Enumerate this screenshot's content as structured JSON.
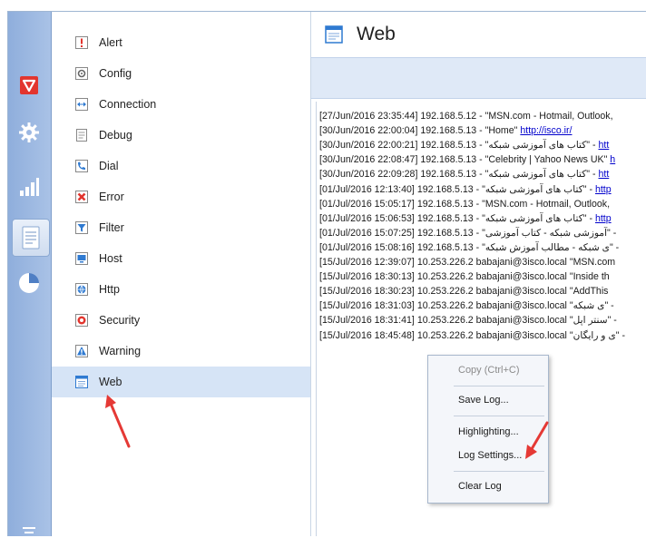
{
  "sidebar_rail": {
    "icons": [
      "shield-icon",
      "gear-icon",
      "signal-bars-icon",
      "document-icon",
      "pie-chart-icon",
      "collapse-icon"
    ],
    "selected": "document-icon"
  },
  "categories": {
    "items": [
      {
        "label": "Alert",
        "icon": "alert-icon"
      },
      {
        "label": "Config",
        "icon": "config-icon"
      },
      {
        "label": "Connection",
        "icon": "connection-icon"
      },
      {
        "label": "Debug",
        "icon": "debug-icon"
      },
      {
        "label": "Dial",
        "icon": "dial-icon"
      },
      {
        "label": "Error",
        "icon": "error-icon"
      },
      {
        "label": "Filter",
        "icon": "filter-icon"
      },
      {
        "label": "Host",
        "icon": "host-icon"
      },
      {
        "label": "Http",
        "icon": "http-icon"
      },
      {
        "label": "Security",
        "icon": "security-icon"
      },
      {
        "label": "Warning",
        "icon": "warning-icon"
      },
      {
        "label": "Web",
        "icon": "web-icon"
      }
    ],
    "selected": "Web"
  },
  "pane": {
    "title": "Web",
    "title_icon": "web-window-icon"
  },
  "log": {
    "lines": [
      {
        "ts": "[27/Jun/2016 23:35:44]",
        "ip": "192.168.5.12",
        "rest": "- \"MSN.com - Hotmail, Outlook,",
        "rtl": "",
        "link": ""
      },
      {
        "ts": "[30/Jun/2016 22:00:04]",
        "ip": "192.168.5.13",
        "rest": "- \"Home\"",
        "rtl": "",
        "link": "http://isco.ir/"
      },
      {
        "ts": "[30/Jun/2016 22:00:21]",
        "ip": "192.168.5.13",
        "rest": "- \"",
        "rtl": "کتاب های آموزشی شبکه",
        "link": "htt"
      },
      {
        "ts": "[30/Jun/2016 22:08:47]",
        "ip": "192.168.5.13",
        "rest": "- \"Celebrity | Yahoo News UK\"",
        "rtl": "",
        "link": "h"
      },
      {
        "ts": "[30/Jun/2016 22:09:28]",
        "ip": "192.168.5.13",
        "rest": "- \"",
        "rtl": "کتاب های آموزشی شبکه",
        "link": "htt"
      },
      {
        "ts": "[01/Jul/2016 12:13:40]",
        "ip": "192.168.5.13",
        "rest": "- \"",
        "rtl": "کتاب های آموزشی شبکه",
        "link": "http"
      },
      {
        "ts": "[01/Jul/2016 15:05:17]",
        "ip": "192.168.5.13",
        "rest": "- \"MSN.com - Hotmail, Outlook,",
        "rtl": "",
        "link": ""
      },
      {
        "ts": "[01/Jul/2016 15:06:53]",
        "ip": "192.168.5.13",
        "rest": "- \"",
        "rtl": "کتاب های آموزشی شبکه",
        "link": "http"
      },
      {
        "ts": "[01/Jul/2016 15:07:25]",
        "ip": "192.168.5.13",
        "rest": "- \"",
        "rtl": "آموزشی شبکه - کتاب آموزشی",
        "link": ""
      },
      {
        "ts": "[01/Jul/2016 15:08:16]",
        "ip": "192.168.5.13",
        "rest": "- \"",
        "rtl": "ی شبکه - مطالب آموزش شبکه",
        "link": ""
      },
      {
        "ts": "[15/Jul/2016 12:39:07]",
        "ip": "10.253.226.2",
        "rest": "babajani@3isco.local \"MSN.com",
        "rtl": "",
        "link": ""
      },
      {
        "ts": "[15/Jul/2016 18:30:13]",
        "ip": "10.253.226.2",
        "rest": "babajani@3isco.local \"Inside th",
        "rtl": "",
        "link": ""
      },
      {
        "ts": "[15/Jul/2016 18:30:23]",
        "ip": "10.253.226.2",
        "rest": "babajani@3isco.local \"AddThis",
        "rtl": "",
        "link": ""
      },
      {
        "ts": "[15/Jul/2016 18:31:03]",
        "ip": "10.253.226.2",
        "rest": "babajani@3isco.local \"",
        "rtl": "ی شبکه",
        "link": ""
      },
      {
        "ts": "[15/Jul/2016 18:31:41]",
        "ip": "10.253.226.2",
        "rest": "babajani@3isco.local \"",
        "rtl": "سنتر اپل",
        "link": ""
      },
      {
        "ts": "[15/Jul/2016 18:45:48]",
        "ip": "10.253.226.2",
        "rest": "babajani@3isco.local \"",
        "rtl": "ی و رایگان",
        "link": ""
      }
    ]
  },
  "context_menu": {
    "copy": "Copy (Ctrl+C)",
    "save_log": "Save Log...",
    "highlighting": "Highlighting...",
    "log_settings": "Log Settings...",
    "clear_log": "Clear Log"
  },
  "colors": {
    "rail": "#9db8e2",
    "selected_row": "#d6e4f6",
    "annotation_arrow": "#e53935",
    "link": "#0000cc"
  }
}
